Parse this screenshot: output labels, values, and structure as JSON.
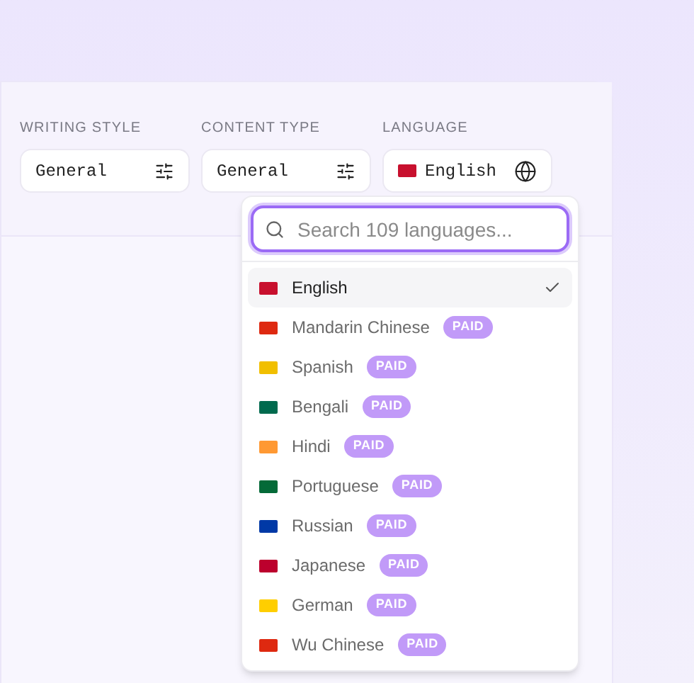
{
  "fields": [
    {
      "label": "WRITING STYLE",
      "value": "General",
      "kind": "options"
    },
    {
      "label": "CONTENT TYPE",
      "value": "General",
      "kind": "options"
    },
    {
      "label": "LANGUAGE",
      "value": "English",
      "kind": "language",
      "color": "#c8102e"
    }
  ],
  "dropdown": {
    "search": {
      "placeholder": "Search 109 languages..."
    },
    "items": [
      {
        "name": "English",
        "selected": true,
        "color": "#c8102e"
      },
      {
        "name": "Mandarin Chinese",
        "selected": false,
        "badge": "PAID",
        "color": "#de2910"
      },
      {
        "name": "Spanish",
        "selected": false,
        "badge": "PAID",
        "color": "#f1bf00"
      },
      {
        "name": "Bengali",
        "selected": false,
        "badge": "PAID",
        "color": "#006a4e"
      },
      {
        "name": "Hindi",
        "selected": false,
        "badge": "PAID",
        "color": "#ff9933"
      },
      {
        "name": "Portuguese",
        "selected": false,
        "badge": "PAID",
        "color": "#046a38"
      },
      {
        "name": "Russian",
        "selected": false,
        "badge": "PAID",
        "color": "#0039a6"
      },
      {
        "name": "Japanese",
        "selected": false,
        "badge": "PAID",
        "color": "#bc002d"
      },
      {
        "name": "German",
        "selected": false,
        "badge": "PAID",
        "color": "#ffce00"
      },
      {
        "name": "Wu Chinese",
        "selected": false,
        "badge": "PAID",
        "color": "#de2910"
      }
    ]
  }
}
